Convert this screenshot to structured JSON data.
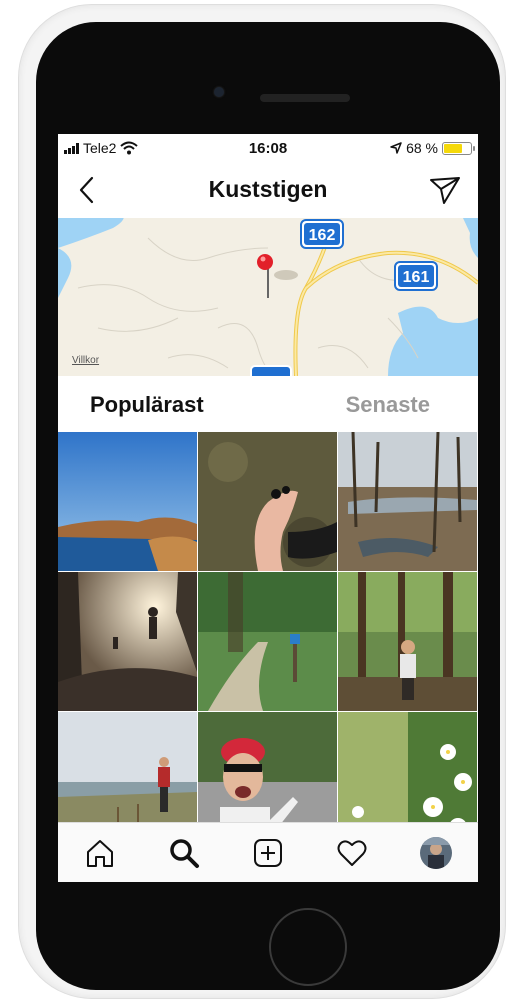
{
  "status_bar": {
    "carrier": "Tele2",
    "time": "16:08",
    "battery_percent": "68 %",
    "battery_level": 0.68
  },
  "header": {
    "title": "Kuststigen"
  },
  "map": {
    "road_labels": [
      "162",
      "161"
    ],
    "terms_link": "Villkor"
  },
  "tabs": [
    {
      "label": "Populärast",
      "active": true
    },
    {
      "label": "Senaste",
      "active": false
    }
  ],
  "tab_bar": {
    "items": [
      "home-icon",
      "search-icon",
      "add-post-icon",
      "heart-icon",
      "profile-avatar"
    ]
  },
  "colors": {
    "battery_fill": "#f5d90a",
    "map_background": "#f3efe4",
    "water": "#9fd3f5",
    "road_sign": "#1f6fd1",
    "pin": "#e2202a"
  }
}
